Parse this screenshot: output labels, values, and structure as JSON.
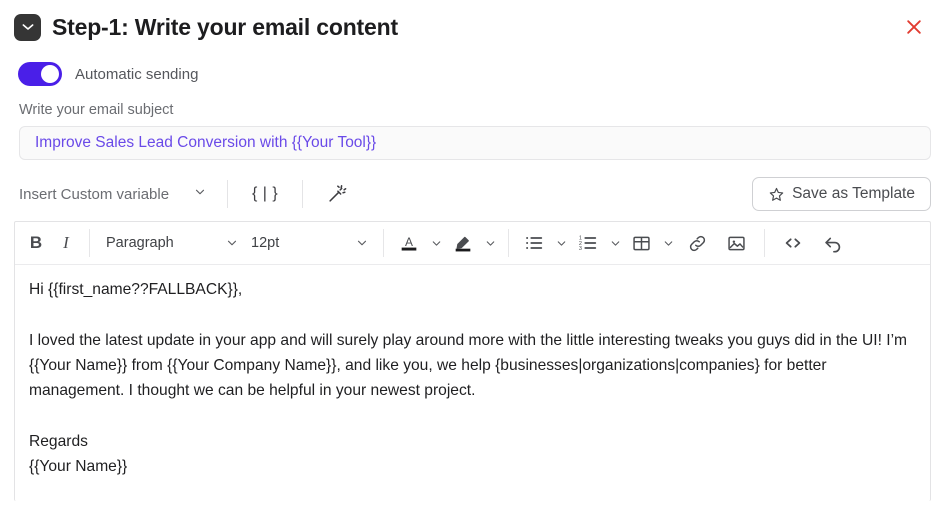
{
  "header": {
    "icon": "envelope-icon",
    "title": "Step-1:  Write your email content",
    "close_icon": "close-icon",
    "close_color": "#e23b30"
  },
  "automatic_sending": {
    "label": "Automatic sending",
    "enabled": true,
    "accent_color": "#4a1fe8"
  },
  "subject": {
    "label": "Write your email subject",
    "value": "Improve Sales Lead Conversion with {{Your Tool}}",
    "placeholder": "Write your email subject",
    "text_color": "#6a4ae8"
  },
  "variable_bar": {
    "insert_variable_label": "Insert Custom variable",
    "chevron_icon": "chevron-down-icon",
    "spintax_label": "{ | }",
    "spintax_icon": "spintax-icon",
    "magic_wand_icon": "magic-wand-icon",
    "save_template_label": "Save as Template",
    "star_icon": "star-icon"
  },
  "toolbar": {
    "bold_label": "B",
    "italic_label": "I",
    "paragraph_value": "Paragraph",
    "font_size_value": "12pt",
    "text_color_icon": "text-color-icon",
    "highlight_icon": "highlight-color-icon",
    "bullet_list_icon": "bullet-list-icon",
    "numbered_list_icon": "numbered-list-icon",
    "table_icon": "table-icon",
    "link_icon": "link-icon",
    "image_icon": "image-icon",
    "code_icon": "code-icon",
    "undo_icon": "undo-icon"
  },
  "body": {
    "greeting": "Hi {{first_name??FALLBACK}},",
    "paragraph": "I loved the latest update in your app and will surely play around more with the little interesting tweaks you guys did in the UI! I’m {{Your Name}} from {{Your Company Name}}, and like you, we help {businesses|organizations|companies} for better management. I thought we can be helpful in your newest project.",
    "signoff": "Regards",
    "signature": "{{Your Name}}"
  }
}
